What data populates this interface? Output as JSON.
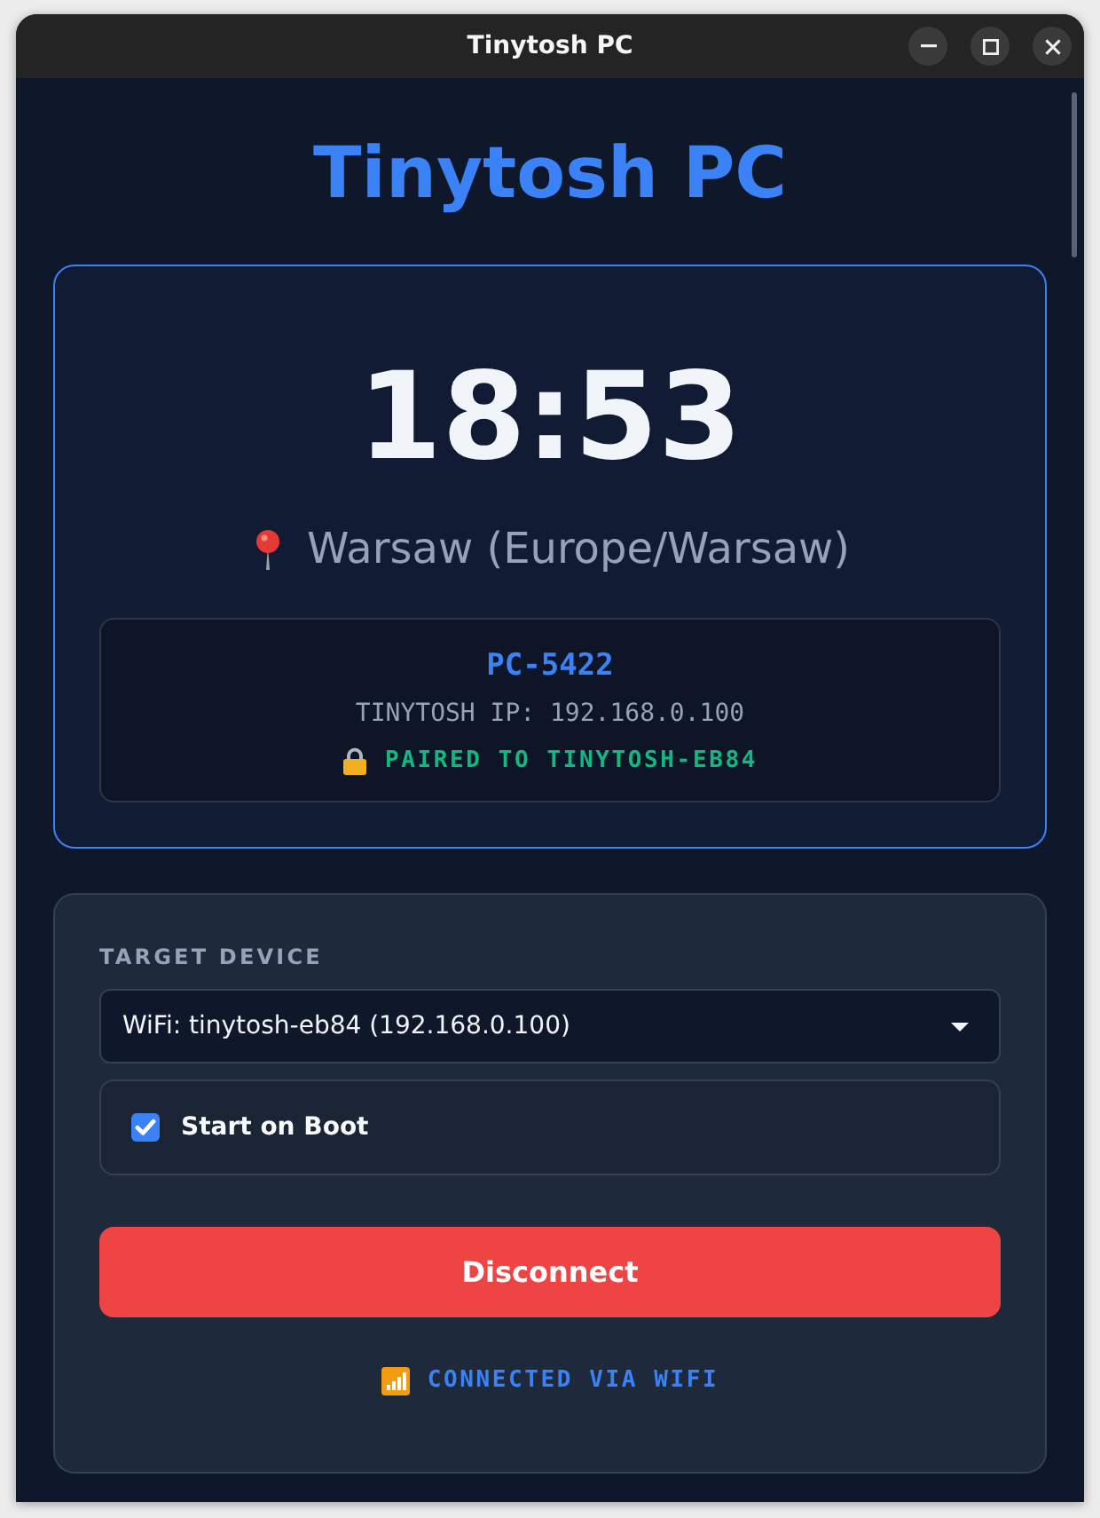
{
  "window": {
    "title": "Tinytosh PC"
  },
  "app_title": "Tinytosh PC",
  "clock": {
    "time": "18:53",
    "location": "Warsaw (Europe/Warsaw)"
  },
  "device_info": {
    "name": "PC-5422",
    "ip_line": "TINYTOSH IP: 192.168.0.100",
    "pairing": "PAIRED TO TINYTOSH-EB84",
    "paired": true
  },
  "controls": {
    "target_label": "TARGET DEVICE",
    "target_select": {
      "value": "WiFi: tinytosh-eb84 (192.168.0.100)"
    },
    "options": [
      {
        "kind": "checkbox",
        "label": "Start on Boot",
        "checked": true
      }
    ],
    "action_button": {
      "label": "Disconnect",
      "kind": "danger"
    },
    "status": {
      "text": "CONNECTED VIA WIFI",
      "kind": "wifi"
    }
  }
}
